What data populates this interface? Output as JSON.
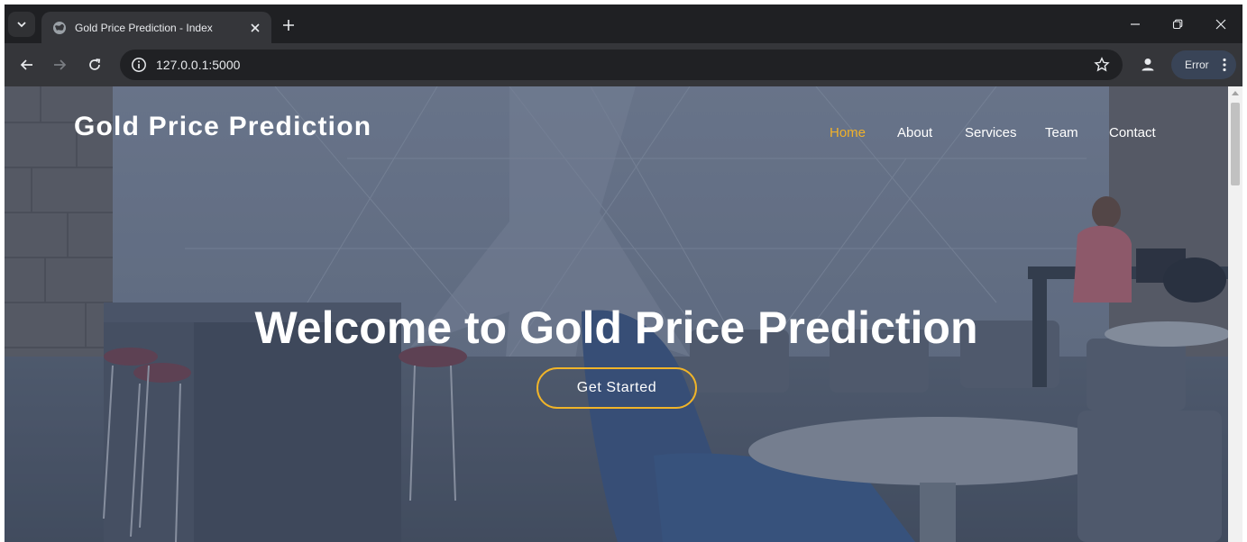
{
  "browser": {
    "tab": {
      "title": "Gold Price Prediction - Index"
    },
    "address": {
      "url": "127.0.0.1:5000"
    },
    "error_chip": {
      "label": "Error"
    }
  },
  "page": {
    "brand": "Gold Price Prediction",
    "nav": [
      {
        "label": "Home",
        "active": true
      },
      {
        "label": "About"
      },
      {
        "label": "Services"
      },
      {
        "label": "Team"
      },
      {
        "label": "Contact"
      }
    ],
    "hero": {
      "headline": "Welcome to Gold Price Prediction",
      "cta": "Get Started"
    }
  },
  "colors": {
    "accent": "#f0b12a",
    "chrome_dark": "#202124",
    "chrome_toolbar": "#35363a",
    "error_chip": "#394457"
  },
  "icons": [
    "tab-search-icon",
    "globe-favicon-icon",
    "close-icon",
    "plus-icon",
    "minimize-icon",
    "restore-icon",
    "back-arrow-icon",
    "forward-arrow-icon",
    "reload-icon",
    "site-info-icon",
    "star-icon",
    "profile-icon",
    "more-vert-icon",
    "scroll-up-icon"
  ]
}
